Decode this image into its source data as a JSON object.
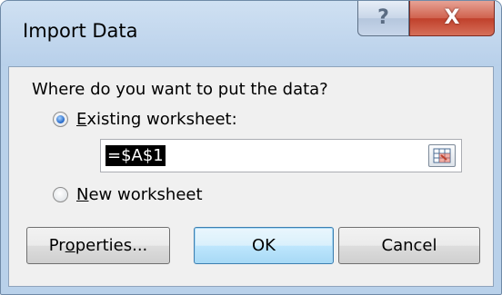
{
  "dialog": {
    "title": "Import Data",
    "help_glyph": "?",
    "close_glyph": "X"
  },
  "prompt": "Where do you want to put the data?",
  "options": [
    {
      "label_access_key": "E",
      "label_rest": "xisting worksheet:",
      "selected": true
    },
    {
      "label_access_key": "N",
      "label_rest": "ew worksheet",
      "selected": false
    }
  ],
  "ref_input": {
    "value": "=$A$1"
  },
  "buttons": {
    "properties_prefix": "Pr",
    "properties_access_key": "o",
    "properties_rest": "perties...",
    "ok": "OK",
    "cancel": "Cancel"
  },
  "colors": {
    "accent": "#3c7fb1",
    "close": "#c0402b",
    "frame": "#b9d1ea"
  }
}
